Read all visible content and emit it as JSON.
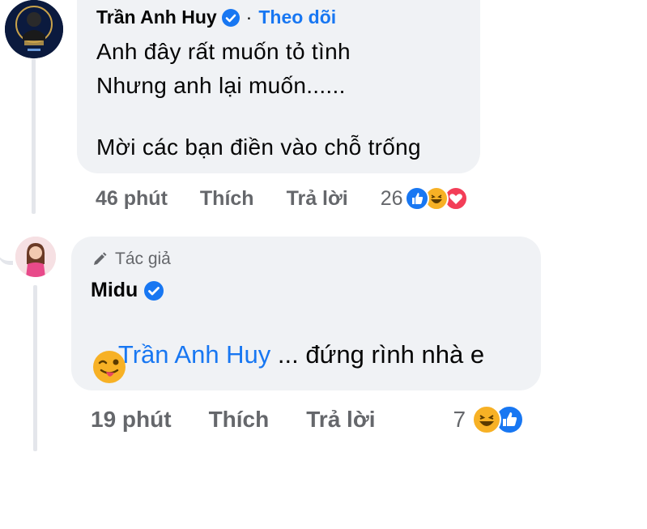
{
  "comment": {
    "author": "Trần Anh Huy",
    "follow_label": "Theo dõi",
    "lines": [
      "Anh đây rất muốn tỏ tình",
      "Nhưng anh lại muốn......",
      "Mời các bạn điền vào chỗ trống"
    ],
    "time": "46 phút",
    "like_label": "Thích",
    "reply_label": "Trả lời",
    "reaction_count": "26",
    "reactions": [
      "like-icon",
      "haha-icon",
      "love-icon"
    ]
  },
  "reply": {
    "author_badge": "Tác giả",
    "author": "Midu",
    "mention": "Trần Anh Huy",
    "text": " ... đứng rình nhà e",
    "emoji": "winking-tongue-face-icon",
    "time": "19 phút",
    "like_label": "Thích",
    "reply_label": "Trả lời",
    "reaction_count": "7",
    "reactions": [
      "haha-icon",
      "like-icon"
    ]
  },
  "colors": {
    "link_blue": "#1877f2",
    "bubble_bg": "#f0f2f5",
    "meta_gray": "#65676b",
    "love_red": "#f33e58",
    "haha_yellow": "#f7b125"
  }
}
